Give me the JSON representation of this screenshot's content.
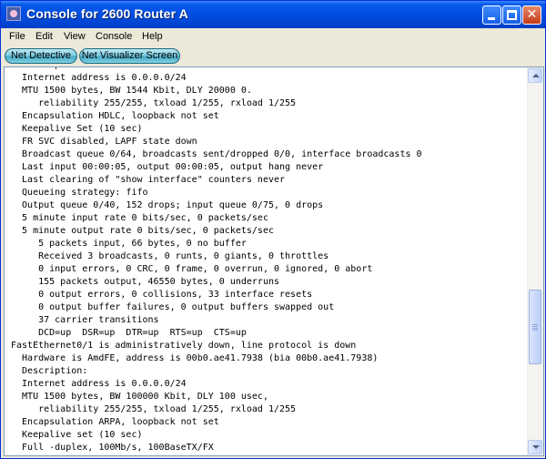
{
  "window": {
    "title": "Console for 2600 Router A",
    "controls": {
      "minimize": "_",
      "maximize": "□",
      "close": "✕"
    }
  },
  "menu": {
    "file": "File",
    "edit": "Edit",
    "view": "View",
    "console": "Console",
    "help": "Help"
  },
  "toolbar": {
    "net_detective": "Net Detective",
    "net_visualizer": "Net Visualizer Screen"
  },
  "console": {
    "text": "  Description:\n  Internet address is 0.0.0.0/24\n  MTU 1500 bytes, BW 1544 Kbit, DLY 20000 0.\n     reliability 255/255, txload 1/255, rxload 1/255\n  Encapsulation HDLC, loopback not set\n  Keepalive Set (10 sec)\n  FR SVC disabled, LAPF state down\n  Broadcast queue 0/64, broadcasts sent/dropped 0/0, interface broadcasts 0\n  Last input 00:00:05, output 00:00:05, output hang never\n  Last clearing of \"show interface\" counters never\n  Queueing strategy: fifo\n  Output queue 0/40, 152 drops; input queue 0/75, 0 drops\n  5 minute input rate 0 bits/sec, 0 packets/sec\n  5 minute output rate 0 bits/sec, 0 packets/sec\n     5 packets input, 66 bytes, 0 no buffer\n     Received 3 broadcasts, 0 runts, 0 giants, 0 throttles\n     0 input errors, 0 CRC, 0 frame, 0 overrun, 0 ignored, 0 abort\n     155 packets output, 46550 bytes, 0 underruns\n     0 output errors, 0 collisions, 33 interface resets\n     0 output buffer failures, 0 output buffers swapped out\n     37 carrier transitions\n     DCD=up  DSR=up  DTR=up  RTS=up  CTS=up\nFastEthernet0/1 is administratively down, line protocol is down\n  Hardware is AmdFE, address is 00b0.ae41.7938 (bia 00b0.ae41.7938)\n  Description:\n  Internet address is 0.0.0.0/24\n  MTU 1500 bytes, BW 100000 Kbit, DLY 100 usec,\n     reliability 255/255, txload 1/255, rxload 1/255\n  Encapsulation ARPA, loopback not set\n  Keepalive set (10 sec)\n  Full -duplex, 100Mb/s, 100BaseTX/FX"
  },
  "scrollbar": {
    "position_fraction": 0.72,
    "visible_fraction": 0.2
  },
  "colors": {
    "titlebar": "#0050e6",
    "toolbar_button": "#49aac4",
    "console_background": "#ffffff"
  }
}
